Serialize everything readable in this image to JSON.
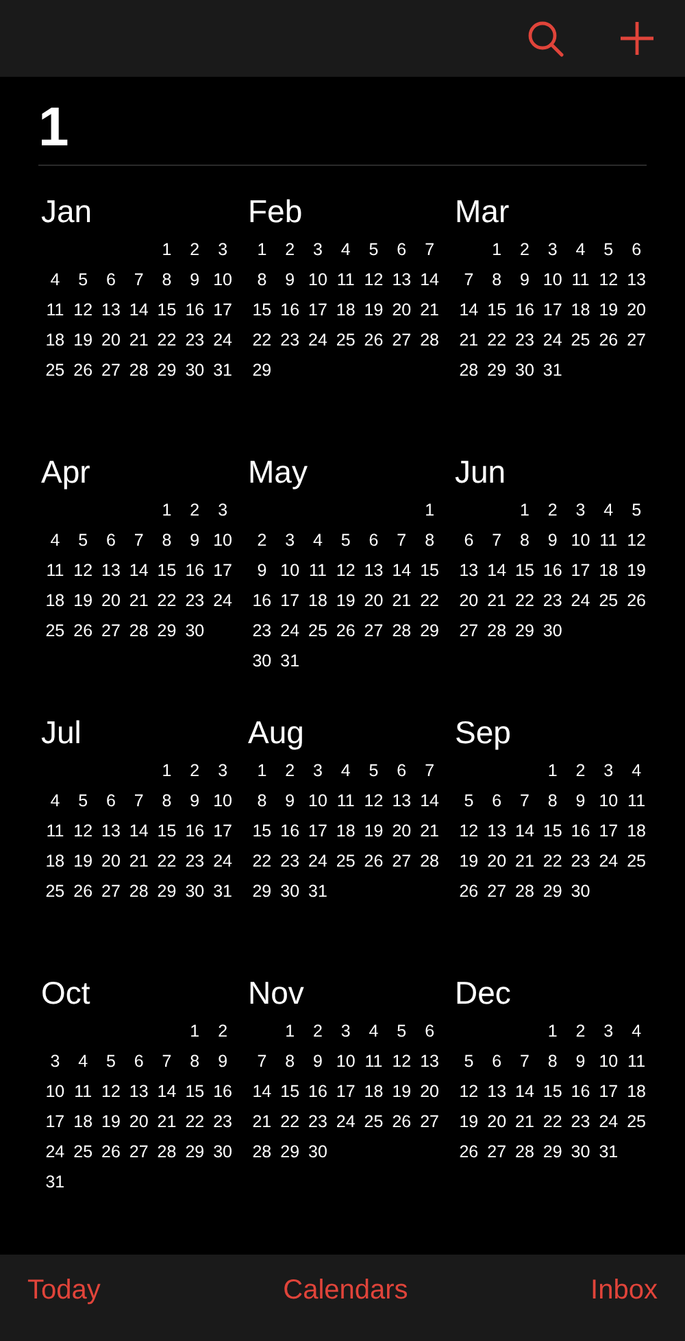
{
  "year": "1",
  "months": [
    {
      "name": "Jan",
      "weeks": [
        [
          "1",
          "2",
          "3"
        ],
        [
          "4",
          "5",
          "6",
          "7",
          "8",
          "9",
          "10"
        ],
        [
          "11",
          "12",
          "13",
          "14",
          "15",
          "16",
          "17"
        ],
        [
          "18",
          "19",
          "20",
          "21",
          "22",
          "23",
          "24"
        ],
        [
          "25",
          "26",
          "27",
          "28",
          "29",
          "30",
          "31"
        ]
      ]
    },
    {
      "name": "Feb",
      "weeks": [
        [
          "1",
          "2",
          "3",
          "4",
          "5",
          "6",
          "7"
        ],
        [
          "8",
          "9",
          "10",
          "11",
          "12",
          "13",
          "14"
        ],
        [
          "15",
          "16",
          "17",
          "18",
          "19",
          "20",
          "21"
        ],
        [
          "22",
          "23",
          "24",
          "25",
          "26",
          "27",
          "28"
        ],
        [
          "29"
        ]
      ]
    },
    {
      "name": "Mar",
      "weeks": [
        [
          "1",
          "2",
          "3",
          "4",
          "5",
          "6"
        ],
        [
          "7",
          "8",
          "9",
          "10",
          "11",
          "12",
          "13"
        ],
        [
          "14",
          "15",
          "16",
          "17",
          "18",
          "19",
          "20"
        ],
        [
          "21",
          "22",
          "23",
          "24",
          "25",
          "26",
          "27"
        ],
        [
          "28",
          "29",
          "30",
          "31"
        ]
      ]
    },
    {
      "name": "Apr",
      "weeks": [
        [
          "1",
          "2",
          "3"
        ],
        [
          "4",
          "5",
          "6",
          "7",
          "8",
          "9",
          "10"
        ],
        [
          "11",
          "12",
          "13",
          "14",
          "15",
          "16",
          "17"
        ],
        [
          "18",
          "19",
          "20",
          "21",
          "22",
          "23",
          "24"
        ],
        [
          "25",
          "26",
          "27",
          "28",
          "29",
          "30"
        ]
      ]
    },
    {
      "name": "May",
      "weeks": [
        [
          "1"
        ],
        [
          "2",
          "3",
          "4",
          "5",
          "6",
          "7",
          "8"
        ],
        [
          "9",
          "10",
          "11",
          "12",
          "13",
          "14",
          "15"
        ],
        [
          "16",
          "17",
          "18",
          "19",
          "20",
          "21",
          "22"
        ],
        [
          "23",
          "24",
          "25",
          "26",
          "27",
          "28",
          "29"
        ],
        [
          "30",
          "31"
        ]
      ]
    },
    {
      "name": "Jun",
      "weeks": [
        [
          "1",
          "2",
          "3",
          "4",
          "5"
        ],
        [
          "6",
          "7",
          "8",
          "9",
          "10",
          "11",
          "12"
        ],
        [
          "13",
          "14",
          "15",
          "16",
          "17",
          "18",
          "19"
        ],
        [
          "20",
          "21",
          "22",
          "23",
          "24",
          "25",
          "26"
        ],
        [
          "27",
          "28",
          "29",
          "30"
        ]
      ]
    },
    {
      "name": "Jul",
      "weeks": [
        [
          "1",
          "2",
          "3"
        ],
        [
          "4",
          "5",
          "6",
          "7",
          "8",
          "9",
          "10"
        ],
        [
          "11",
          "12",
          "13",
          "14",
          "15",
          "16",
          "17"
        ],
        [
          "18",
          "19",
          "20",
          "21",
          "22",
          "23",
          "24"
        ],
        [
          "25",
          "26",
          "27",
          "28",
          "29",
          "30",
          "31"
        ]
      ]
    },
    {
      "name": "Aug",
      "weeks": [
        [
          "1",
          "2",
          "3",
          "4",
          "5",
          "6",
          "7"
        ],
        [
          "8",
          "9",
          "10",
          "11",
          "12",
          "13",
          "14"
        ],
        [
          "15",
          "16",
          "17",
          "18",
          "19",
          "20",
          "21"
        ],
        [
          "22",
          "23",
          "24",
          "25",
          "26",
          "27",
          "28"
        ],
        [
          "29",
          "30",
          "31"
        ]
      ]
    },
    {
      "name": "Sep",
      "weeks": [
        [
          "1",
          "2",
          "3",
          "4"
        ],
        [
          "5",
          "6",
          "7",
          "8",
          "9",
          "10",
          "11"
        ],
        [
          "12",
          "13",
          "14",
          "15",
          "16",
          "17",
          "18"
        ],
        [
          "19",
          "20",
          "21",
          "22",
          "23",
          "24",
          "25"
        ],
        [
          "26",
          "27",
          "28",
          "29",
          "30"
        ]
      ]
    },
    {
      "name": "Oct",
      "weeks": [
        [
          "1",
          "2"
        ],
        [
          "3",
          "4",
          "5",
          "6",
          "7",
          "8",
          "9"
        ],
        [
          "10",
          "11",
          "12",
          "13",
          "14",
          "15",
          "16"
        ],
        [
          "17",
          "18",
          "19",
          "20",
          "21",
          "22",
          "23"
        ],
        [
          "24",
          "25",
          "26",
          "27",
          "28",
          "29",
          "30"
        ],
        [
          "31"
        ]
      ]
    },
    {
      "name": "Nov",
      "weeks": [
        [
          "1",
          "2",
          "3",
          "4",
          "5",
          "6"
        ],
        [
          "7",
          "8",
          "9",
          "10",
          "11",
          "12",
          "13"
        ],
        [
          "14",
          "15",
          "16",
          "17",
          "18",
          "19",
          "20"
        ],
        [
          "21",
          "22",
          "23",
          "24",
          "25",
          "26",
          "27"
        ],
        [
          "28",
          "29",
          "30"
        ]
      ]
    },
    {
      "name": "Dec",
      "weeks": [
        [
          "1",
          "2",
          "3",
          "4"
        ],
        [
          "5",
          "6",
          "7",
          "8",
          "9",
          "10",
          "11"
        ],
        [
          "12",
          "13",
          "14",
          "15",
          "16",
          "17",
          "18"
        ],
        [
          "19",
          "20",
          "21",
          "22",
          "23",
          "24",
          "25"
        ],
        [
          "26",
          "27",
          "28",
          "29",
          "30",
          "31"
        ]
      ]
    }
  ],
  "tab_bar": [
    "Today",
    "Calendars",
    "Inbox"
  ]
}
